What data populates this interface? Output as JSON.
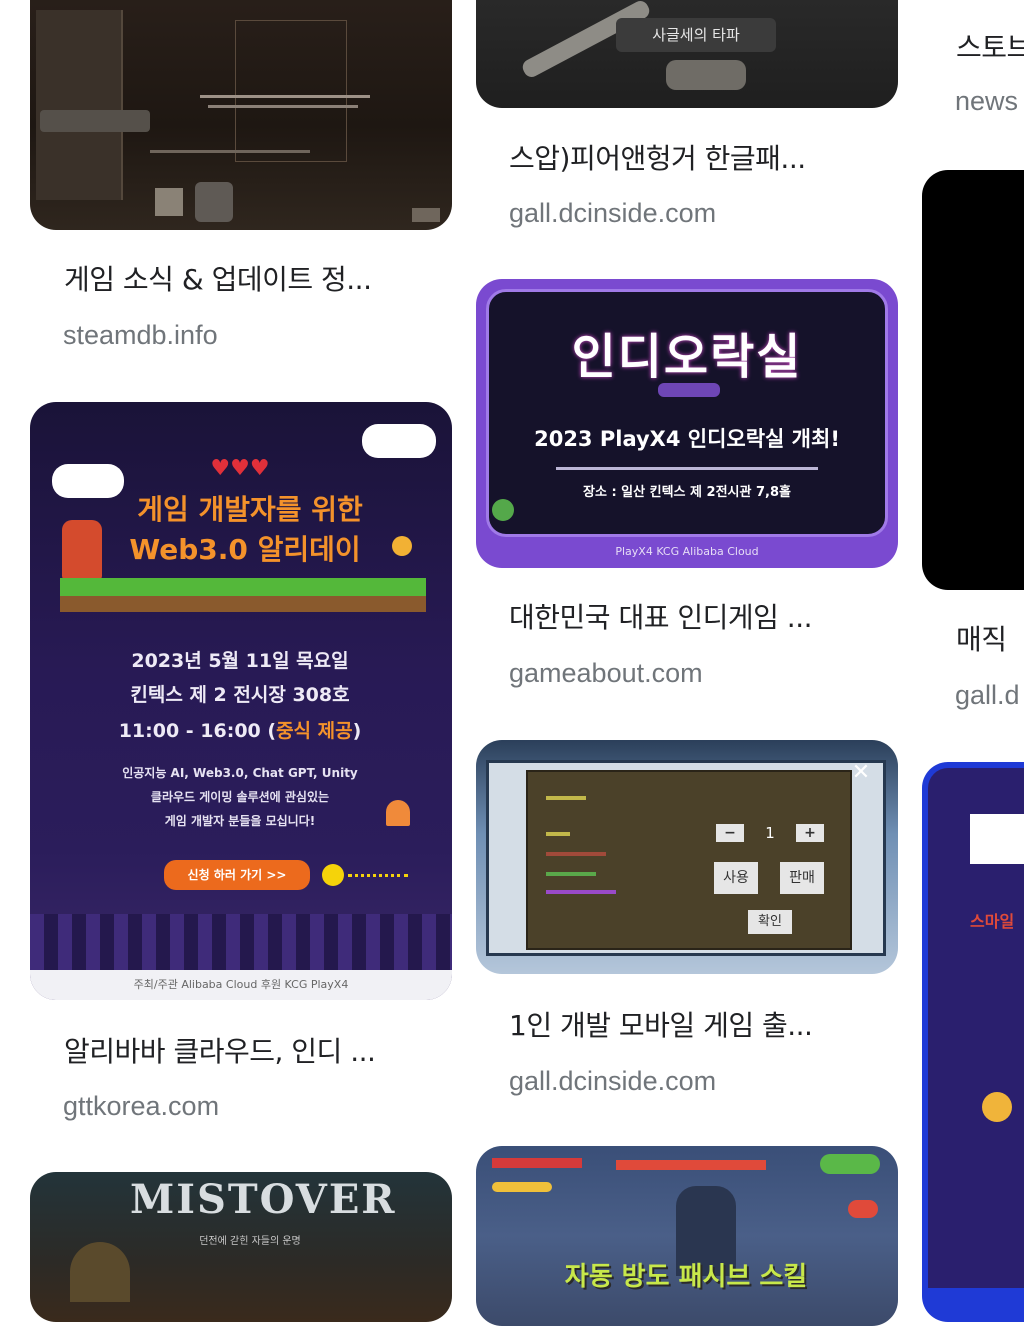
{
  "results": [
    {
      "title": "게임 소식 & 업데이트 정...",
      "source": "steamdb.info"
    },
    {
      "title": "스압)피어앤헝거 한글패...",
      "source": "gall.dcinside.com",
      "image_caption": "사글세의 타파"
    },
    {
      "title": "",
      "source": "news",
      "title_partial": "스토브"
    },
    {
      "title": "대한민국 대표 인디게임 ...",
      "source": "gameabout.com",
      "image": {
        "logo_text": "인디오락실",
        "headline": "2023 PlayX4 인디오락실 개최!",
        "detail": "장소 : 일산 킨텍스 제 2전시관 7,8홀",
        "sponsors": "PlayX4   KCG   Alibaba Cloud"
      }
    },
    {
      "title": "알리바바 클라우드, 인디 ...",
      "source": "gttkorea.com",
      "image": {
        "headline_1": "게임 개발자를 위한",
        "headline_2": "Web3.0 알리데이",
        "date": "2023년 5월 11일 목요일",
        "venue": "킨텍스 제 2 전시장 308호",
        "time_prefix": "11:00 - 16:00 (",
        "time_highlight": "중식 제공",
        "time_suffix": ")",
        "desc_1": "인공지능 AI, Web3.0, Chat GPT, Unity",
        "desc_2": "클라우드 게이밍 솔루션에 관심있는",
        "desc_3": "게임 개발자 분들을 모십니다!",
        "cta": "신청 하러 가기 >>",
        "footer": "주최/주관  Alibaba Cloud   후원  KCG  PlayX4"
      }
    },
    {
      "title": "매직",
      "source": "gall.d"
    },
    {
      "title": "1인 개발 모바일 게임 출...",
      "source": "gall.dcinside.com",
      "image": {
        "close": "✕",
        "minus": "−",
        "qty": "1",
        "plus": "+",
        "use": "사용",
        "buy": "판매",
        "confirm": "확인"
      }
    },
    {
      "image_text": "MISTOVER",
      "image_subtext": "던전에 갇힌 자들의 운명"
    },
    {
      "image_text": "자동 방도 패시브 스킬"
    },
    {
      "image_text": "스마일"
    }
  ]
}
